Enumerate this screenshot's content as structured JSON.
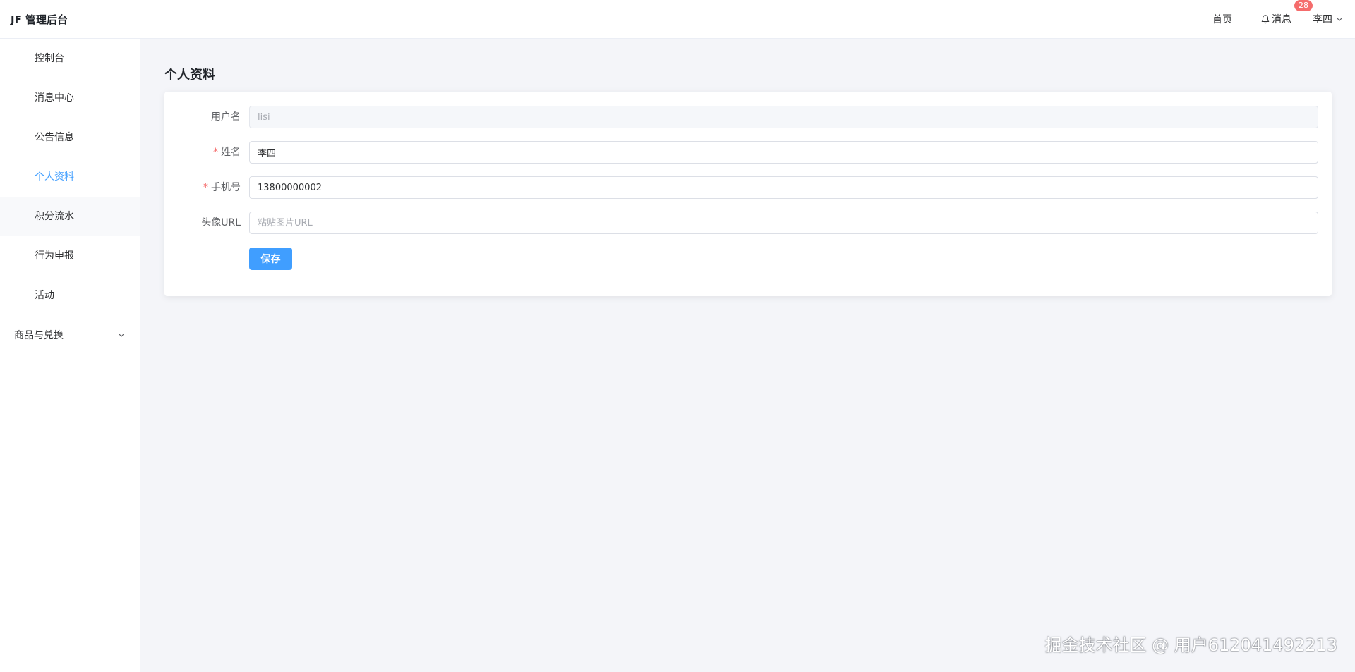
{
  "header": {
    "brand": "JF 管理后台",
    "home": "首页",
    "messages": "消息",
    "message_count": "28",
    "user": "李四"
  },
  "sidebar": {
    "items": [
      {
        "label": "控制台"
      },
      {
        "label": "消息中心"
      },
      {
        "label": "公告信息"
      },
      {
        "label": "个人资料"
      },
      {
        "label": "积分流水"
      },
      {
        "label": "行为申报"
      },
      {
        "label": "活动"
      }
    ],
    "submenu": "商品与兑换"
  },
  "page": {
    "title": "个人资料"
  },
  "form": {
    "username_label": "用户名",
    "username_value": "lisi",
    "name_label": "姓名",
    "name_value": "李四",
    "phone_label": "手机号",
    "phone_value": "13800000002",
    "avatar_label": "头像URL",
    "avatar_placeholder": "粘贴图片URL",
    "required_mark": "*",
    "save": "保存"
  },
  "watermark": "掘金技术社区 @ 用户612041492213",
  "colors": {
    "accent": "#409eff",
    "badge": "#f56c6c",
    "background": "#f4f5f9"
  }
}
